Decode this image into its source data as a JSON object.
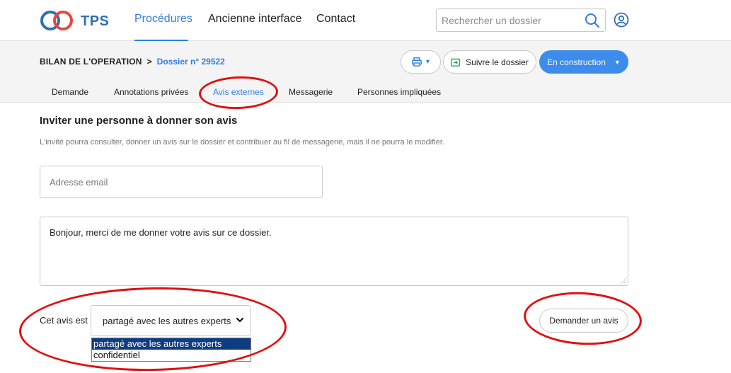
{
  "header": {
    "logo_text": "TPS",
    "nav": [
      {
        "label": "Procédures",
        "active": true
      },
      {
        "label": "Ancienne interface",
        "active": false
      },
      {
        "label": "Contact",
        "active": false
      }
    ],
    "search_placeholder": "Rechercher un dossier",
    "search_icon": "search-icon",
    "user_icon": "user-circle-icon"
  },
  "subheader": {
    "breadcrumb": {
      "procedure": "BILAN DE L'OPERATION",
      "separator": ">",
      "dossier": "Dossier n° 29522"
    },
    "print_icon": "printer-icon",
    "print_caret": "▾",
    "follow_label": "Suivre le dossier",
    "follow_icon": "follow-icon",
    "status_label": "En construction",
    "status_caret": "▼",
    "tabs": [
      {
        "label": "Demande",
        "active": false
      },
      {
        "label": "Annotations privées",
        "active": false
      },
      {
        "label": "Avis externes",
        "active": true
      },
      {
        "label": "Messagerie",
        "active": false
      },
      {
        "label": "Personnes impliquées",
        "active": false
      }
    ]
  },
  "form": {
    "title": "Inviter une personne à donner son avis",
    "hint": "L'invité pourra consulter, donner un avis sur le dossier et contribuer au fil de messagerie, mais il ne pourra le modifier.",
    "email_placeholder": "Adresse email",
    "message_value": "Bonjour, merci de me donner votre avis sur ce dossier.",
    "confidentiality_label": "Cet avis est",
    "confidentiality_selected": "partagé avec les autres experts",
    "confidentiality_options": [
      "partagé avec les autres experts",
      "confidentiel"
    ],
    "submit_label": "Demander un avis"
  },
  "colors": {
    "accent": "#2f7de1",
    "status_button": "#3d8bea",
    "annotation_red": "#e01010",
    "dropdown_selected": "#0f3c82"
  }
}
